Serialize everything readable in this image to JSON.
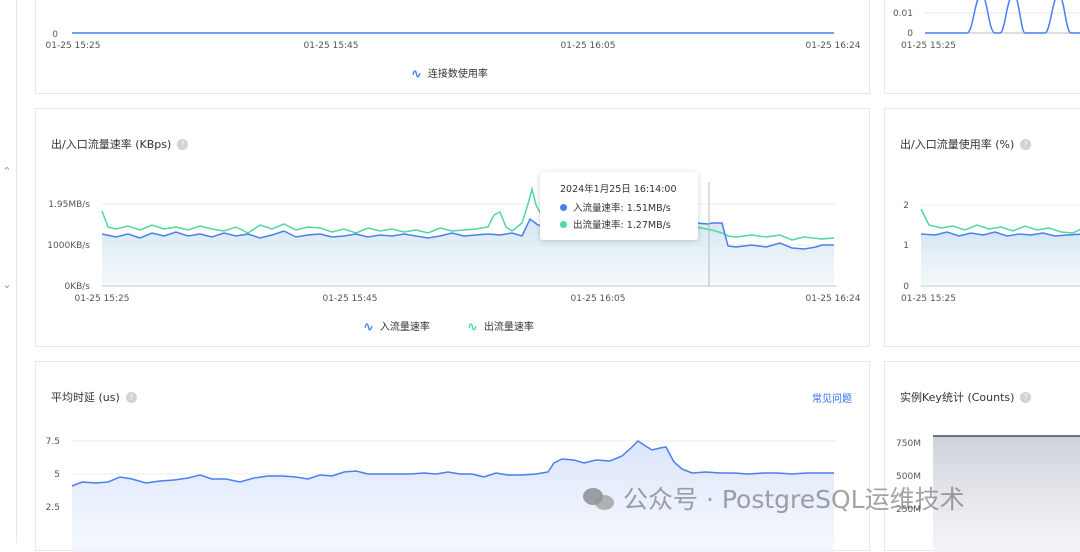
{
  "rail": {
    "up_icon": "chevron-up-icon",
    "down_icon": "chevron-down-icon"
  },
  "panel_connection": {
    "legend": "连接数使用率",
    "x_ticks": [
      "01-25 15:25",
      "01-25 15:45",
      "01-25 16:05",
      "01-25 16:24"
    ],
    "y_ticks": [
      "0"
    ],
    "color": "#4a7ff0"
  },
  "panel_small_top": {
    "y_ticks": [
      "0.01",
      "0"
    ],
    "x_ticks": [
      "01-25 15:25"
    ]
  },
  "panel_traffic": {
    "title": "出/入口流量速率 (KBps)",
    "y_ticks": [
      "1.95MB/s",
      "1000KB/s",
      "0KB/s"
    ],
    "x_ticks": [
      "01-25 15:25",
      "01-25 15:45",
      "01-25 16:05",
      "01-25 16:24"
    ],
    "legend_in": "入流量速率",
    "legend_out": "出流量速率",
    "colors": {
      "in": "#4a7ff0",
      "out": "#4fd8a0"
    },
    "tooltip": {
      "time": "2024年1月25日 16:14:00",
      "in_label": "入流量速率: 1.51MB/s",
      "out_label": "出流量速率: 1.27MB/s"
    }
  },
  "panel_traffic_usage": {
    "title": "出/入口流量使用率 (%)",
    "y_ticks": [
      "2",
      "1",
      "0"
    ],
    "x_ticks": [
      "01-25 15:25"
    ]
  },
  "panel_latency": {
    "title": "平均时延 (us)",
    "faq": "常见问题",
    "y_ticks": [
      "7.5",
      "5",
      "2.5"
    ]
  },
  "panel_keys": {
    "title": "实例Key统计 (Counts)",
    "y_ticks": [
      "750M",
      "500M",
      "250M"
    ]
  },
  "watermark": {
    "text": "公众号 · PostgreSQL运维技术"
  }
}
